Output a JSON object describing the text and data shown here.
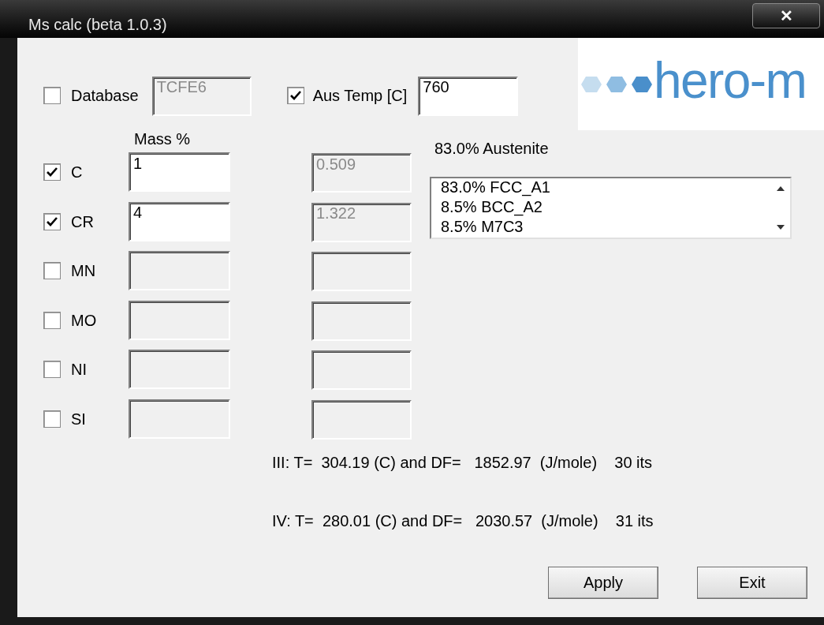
{
  "window": {
    "title": "Ms calc (beta 1.0.3)",
    "close": "✕"
  },
  "database": {
    "label": "Database",
    "checked": false,
    "value": "TCFE6"
  },
  "aus_temp": {
    "label": "Aus Temp [C]",
    "checked": true,
    "value": "760"
  },
  "logo": {
    "text": "hero-m"
  },
  "mass_header": "Mass %",
  "elements": [
    {
      "symbol": "C",
      "checked": true,
      "mass": "1",
      "result": "0.509"
    },
    {
      "symbol": "CR",
      "checked": true,
      "mass": "4",
      "result": "1.322"
    },
    {
      "symbol": "MN",
      "checked": false
    },
    {
      "symbol": "MO",
      "checked": false
    },
    {
      "symbol": "NI",
      "checked": false
    },
    {
      "symbol": "SI",
      "checked": false
    }
  ],
  "austenite": "83.0% Austenite",
  "phases": [
    "83.0% FCC_A1",
    "8.5% BCC_A2",
    "8.5% M7C3"
  ],
  "results": [
    "III: T=  304.19 (C) and DF=   1852.97  (J/mole)    30 its",
    "IV: T=  280.01 (C) and DF=   2030.57  (J/mole)    31 its"
  ],
  "buttons": [
    "Apply",
    "Exit"
  ]
}
